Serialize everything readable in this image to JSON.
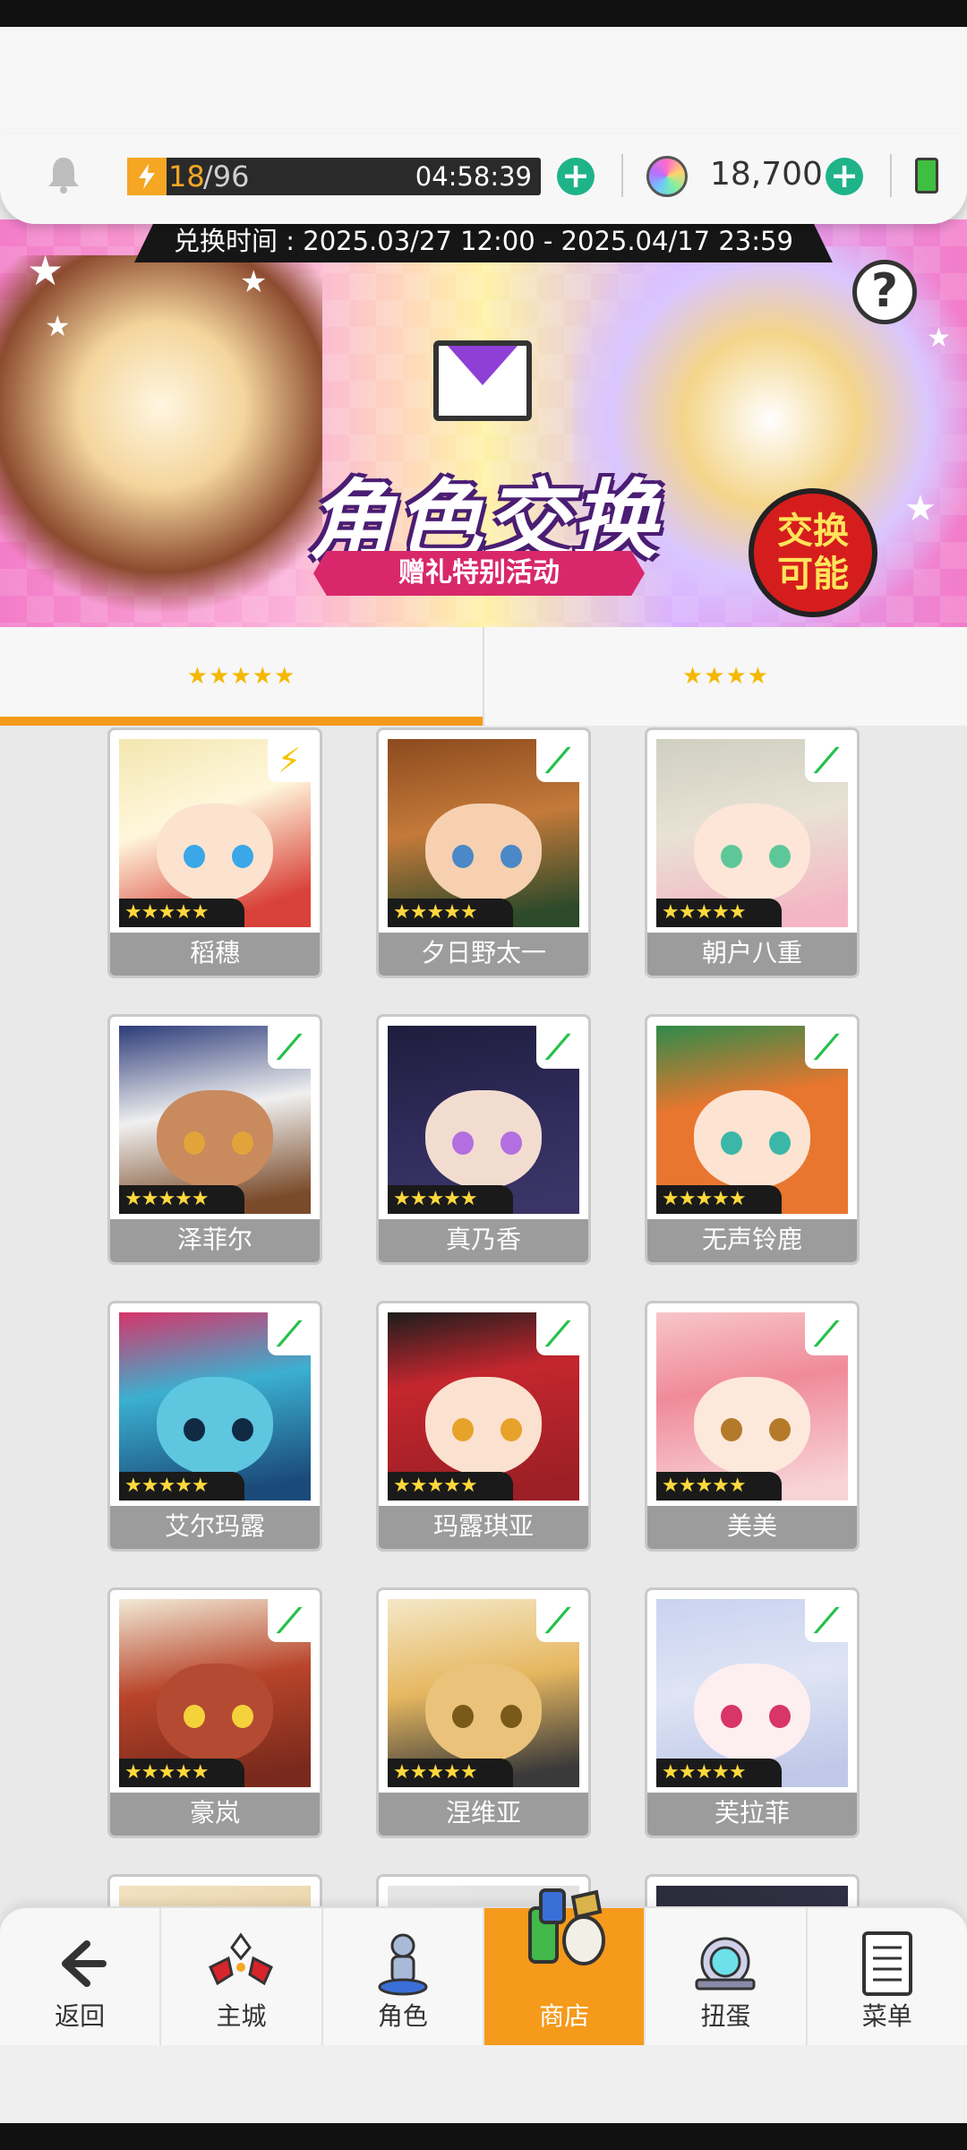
{
  "resources": {
    "stamina_current": "18",
    "stamina_max": "96",
    "stamina_timer": "04:58:39",
    "gems": "18,700",
    "colors": {
      "stamina": "#f5a623",
      "plus": "#1fb38a",
      "accent": "#f59a1b"
    }
  },
  "banner": {
    "period": "兑换时间 : 2025.03/27 12:00 - 2025.04/17 23:59",
    "title": "角色交换",
    "subtitle": "赠礼特别活动",
    "badge": "交换\n可能",
    "help": "?"
  },
  "tabs": [
    {
      "label": "★★★★★",
      "active": true
    },
    {
      "label": "★★★★",
      "active": false
    }
  ],
  "characters": [
    {
      "name": "稻穗",
      "rarity": "★★★★★",
      "element": "bolt-icon",
      "element_glyph": "⚡"
    },
    {
      "name": "夕日野太一",
      "rarity": "★★★★★",
      "element": "leaf-icon",
      "element_glyph": "⟋"
    },
    {
      "name": "朝户八重",
      "rarity": "★★★★★",
      "element": "leaf-icon",
      "element_glyph": "⟋"
    },
    {
      "name": "泽菲尔",
      "rarity": "★★★★★",
      "element": "leaf-icon",
      "element_glyph": "⟋"
    },
    {
      "name": "真乃香",
      "rarity": "★★★★★",
      "element": "leaf-icon",
      "element_glyph": "⟋"
    },
    {
      "name": "无声铃鹿",
      "rarity": "★★★★★",
      "element": "leaf-icon",
      "element_glyph": "⟋"
    },
    {
      "name": "艾尔玛露",
      "rarity": "★★★★★",
      "element": "leaf-icon",
      "element_glyph": "⟋"
    },
    {
      "name": "玛露琪亚",
      "rarity": "★★★★★",
      "element": "leaf-icon",
      "element_glyph": "⟋"
    },
    {
      "name": "美美",
      "rarity": "★★★★★",
      "element": "leaf-icon",
      "element_glyph": "⟋"
    },
    {
      "name": "豪岚",
      "rarity": "★★★★★",
      "element": "leaf-icon",
      "element_glyph": "⟋"
    },
    {
      "name": "涅维亚",
      "rarity": "★★★★★",
      "element": "leaf-icon",
      "element_glyph": "⟋"
    },
    {
      "name": "芙拉菲",
      "rarity": "★★★★★",
      "element": "leaf-icon",
      "element_glyph": "⟋"
    }
  ],
  "nav": [
    {
      "label": "返回",
      "icon": "back-arrow-icon"
    },
    {
      "label": "主城",
      "icon": "castle-icon"
    },
    {
      "label": "角色",
      "icon": "character-icon"
    },
    {
      "label": "商店",
      "icon": "shop-icon",
      "active": true
    },
    {
      "label": "扭蛋",
      "icon": "gacha-icon"
    },
    {
      "label": "菜单",
      "icon": "menu-icon"
    }
  ]
}
